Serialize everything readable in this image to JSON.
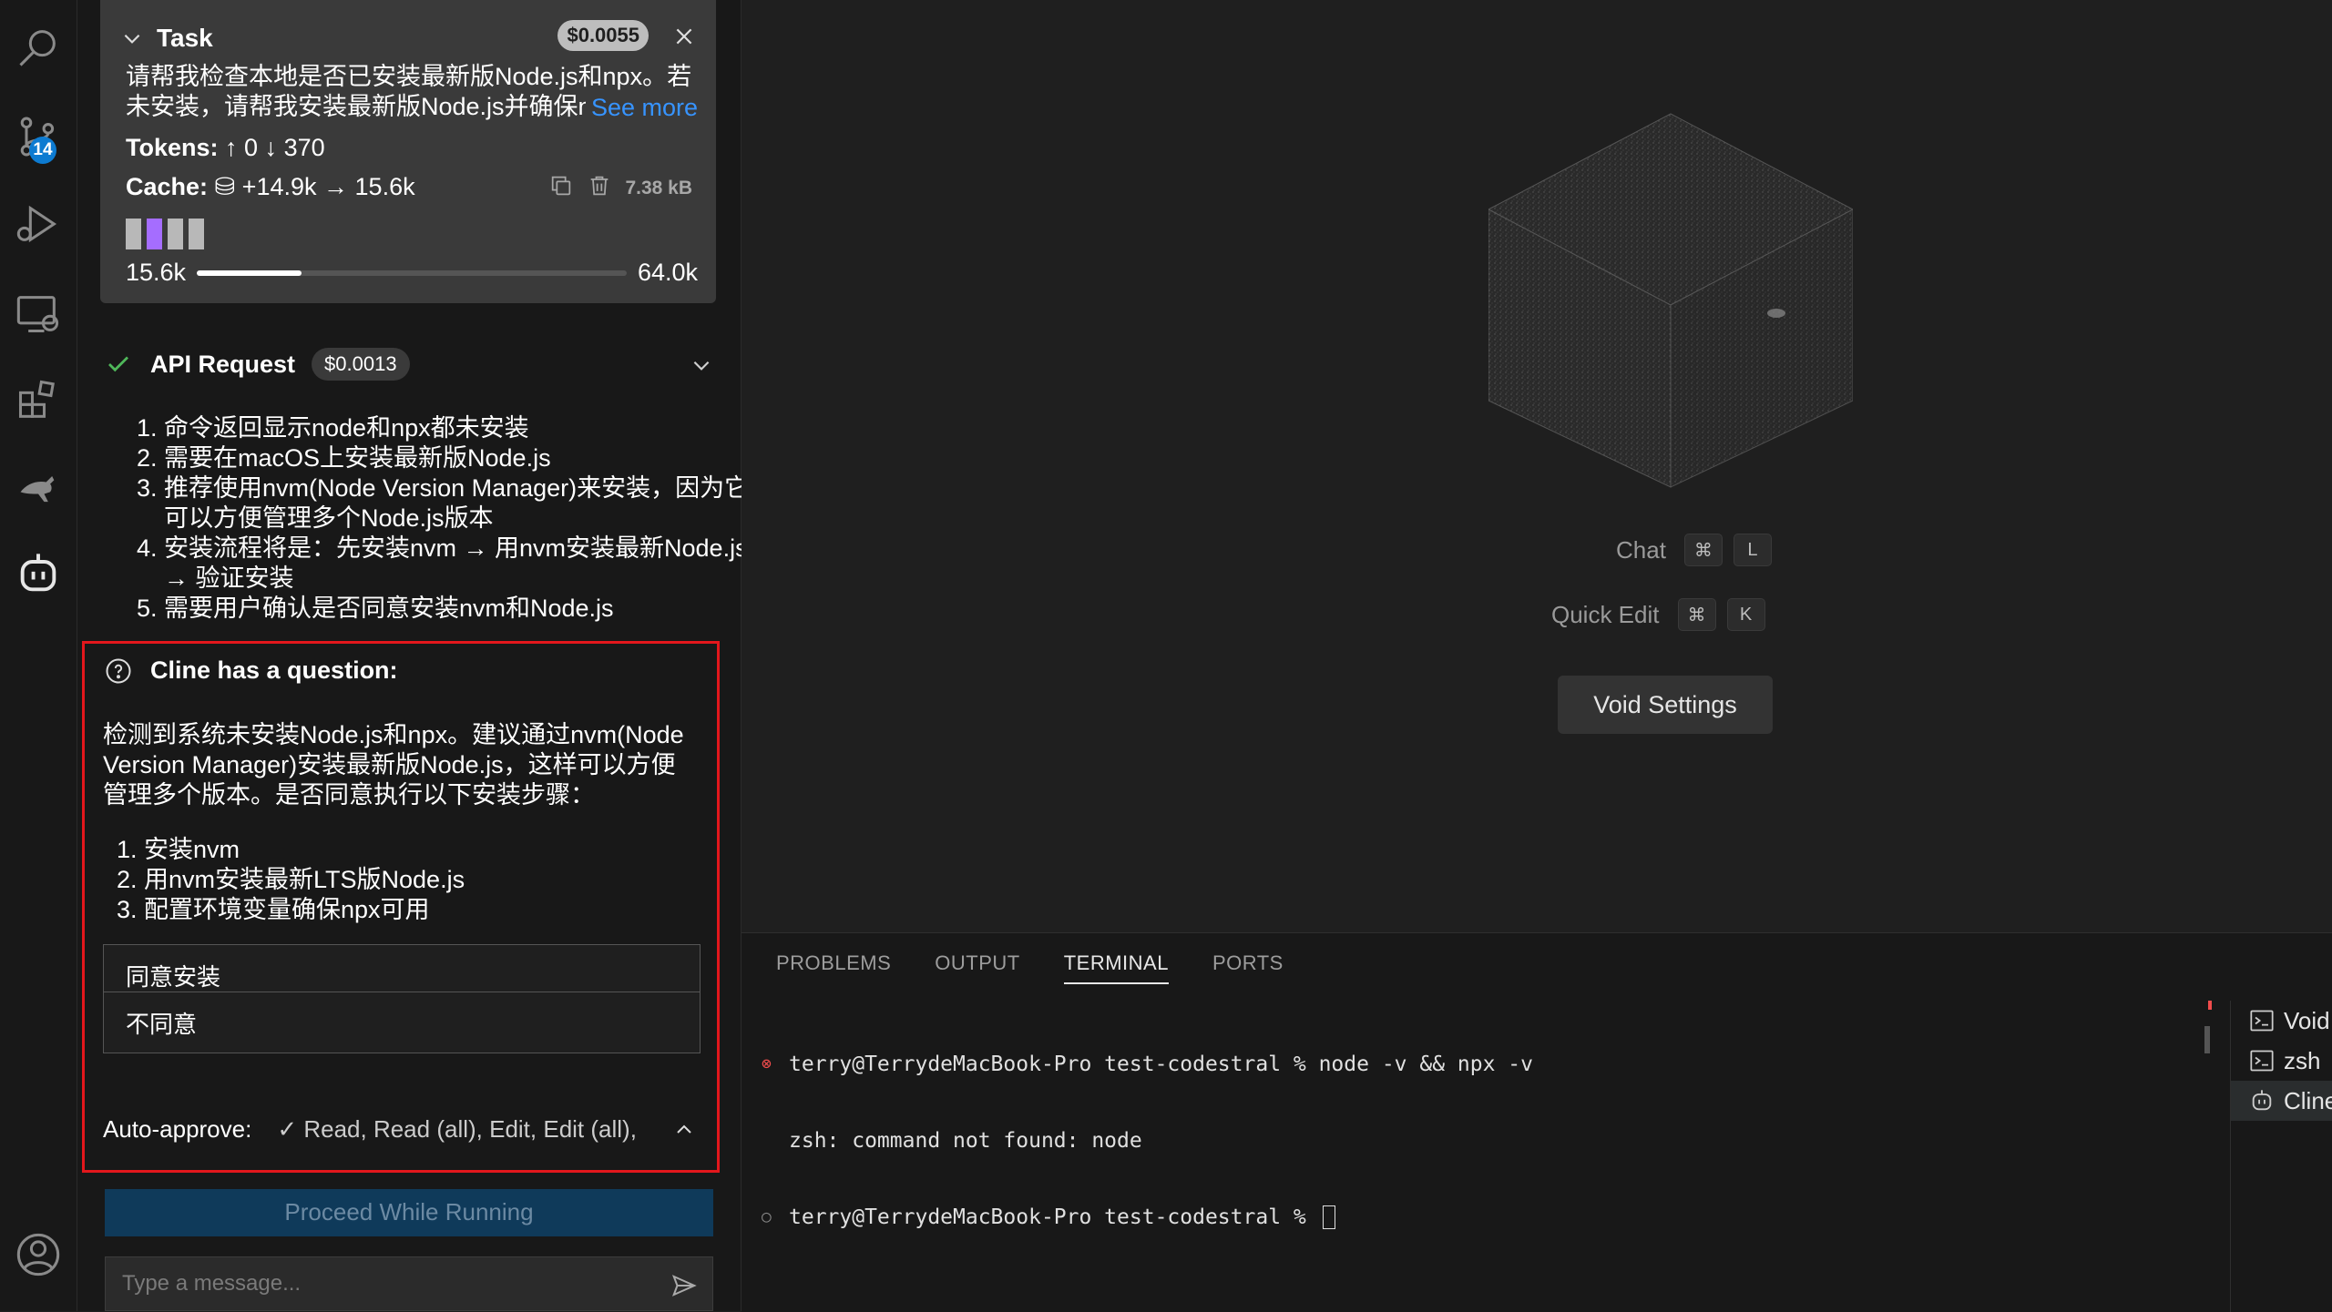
{
  "activity_bar": {
    "source_control_badge": "14"
  },
  "task": {
    "title": "Task",
    "cost": "$0.0055",
    "text": "请帮我检查本地是否已安装最新版Node.js和npx。若未安装，请帮我安装最新版Node.js并确保npx可用",
    "see_more": "See more",
    "tokens_label": "Tokens:",
    "tokens_in": "0",
    "tokens_out": "370",
    "cache_label": "Cache:",
    "cache_write": "+14.9k",
    "cache_read": "15.6k",
    "size": "7.38 kB",
    "context_used": "15.6k",
    "context_max": "64.0k",
    "context_fraction": 0.244
  },
  "api_request": {
    "title": "API Request",
    "cost": "$0.0013",
    "steps": [
      "命令返回显示node和npx都未安装",
      "需要在macOS上安装最新版Node.js",
      "推荐使用nvm(Node Version Manager)来安装，因为它可以方便管理多个Node.js版本",
      "安装流程将是：先安装nvm → 用nvm安装最新Node.js → 验证安装",
      "需要用户确认是否同意安装nvm和Node.js"
    ]
  },
  "question": {
    "title": "Cline has a question:",
    "body": "检测到系统未安装Node.js和npx。建议通过nvm(Node Version Manager)安装最新版Node.js，这样可以方便管理多个版本。是否同意执行以下安装步骤：",
    "steps": [
      "安装nvm",
      "用nvm安装最新LTS版Node.js",
      "配置环境变量确保npx可用"
    ],
    "option_agree": "同意安装",
    "option_disagree": "不同意",
    "auto_approve_label": "Auto-approve:",
    "auto_approve_values": "✓ Read, Read (all), Edit, Edit (all),"
  },
  "proceed_button": "Proceed While Running",
  "message_input": {
    "placeholder": "Type a message..."
  },
  "welcome": {
    "chat_label": "Chat",
    "chat_key1": "⌘",
    "chat_key2": "L",
    "quick_edit_label": "Quick Edit",
    "quick_edit_key1": "⌘",
    "quick_edit_key2": "K",
    "settings_button": "Void Settings"
  },
  "panel": {
    "tabs": [
      "PROBLEMS",
      "OUTPUT",
      "TERMINAL",
      "PORTS"
    ],
    "active_tab": "TERMINAL",
    "terminal_lines": [
      "terry@TerrydeMacBook-Pro test-codestral % node -v && npx -v",
      "zsh: command not found: node",
      "terry@TerrydeMacBook-Pro test-codestral % "
    ],
    "terminals": [
      "Void",
      "zsh",
      "Cline"
    ]
  },
  "colors": {
    "accent": "#0d7bd1",
    "highlight_border": "#e3171c",
    "link": "#3794ff"
  }
}
